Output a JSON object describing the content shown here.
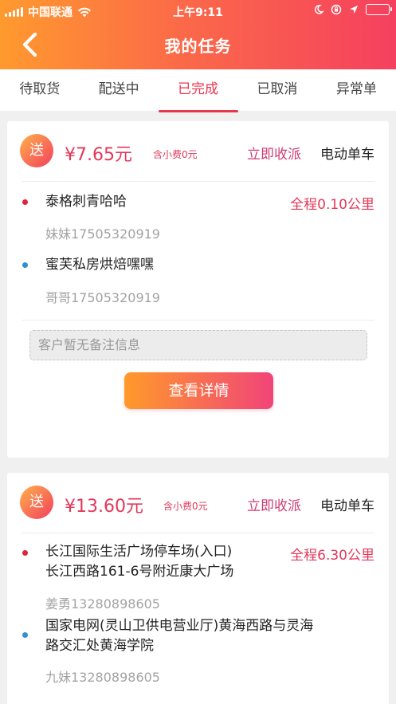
{
  "status_bar": {
    "carrier": "中国联通",
    "time": "上午9:11"
  },
  "header": {
    "title": "我的任务"
  },
  "tabs": [
    "待取货",
    "配送中",
    "已完成",
    "已取消",
    "异常单"
  ],
  "active_tab": 2,
  "colors": {
    "accent": "#e3385a",
    "header_start": "#ff9a2e",
    "header_end": "#f5405f"
  },
  "orders": [
    {
      "badge": "送",
      "price": "¥7.65元",
      "tip": "含小费0元",
      "action": "立即收派",
      "vehicle": "电动单车",
      "pickup_name": "泰格刺青哈哈",
      "pickup_contact": "妹妹17505320919",
      "distance": "全程0.10公里",
      "dropoff_name": "蜜芙私房烘焙嘿嘿",
      "dropoff_contact": "哥哥17505320919",
      "remark_placeholder": "客户暂无备注信息",
      "detail_button": "查看详情"
    },
    {
      "badge": "送",
      "price": "¥13.60元",
      "tip": "含小费0元",
      "action": "立即收派",
      "vehicle": "电动单车",
      "pickup_name_line1": "长江国际生活广场停车场(入口)",
      "pickup_name_line2": "长江西路161-6号附近康大广场",
      "pickup_contact": "姜勇13280898605",
      "distance": "全程6.30公里",
      "dropoff_name_line1": "国家电网(灵山卫供电营业厅)黄海西路与灵海",
      "dropoff_name_line2": "路交汇处黄海学院",
      "dropoff_contact": "九妹13280898605"
    }
  ]
}
